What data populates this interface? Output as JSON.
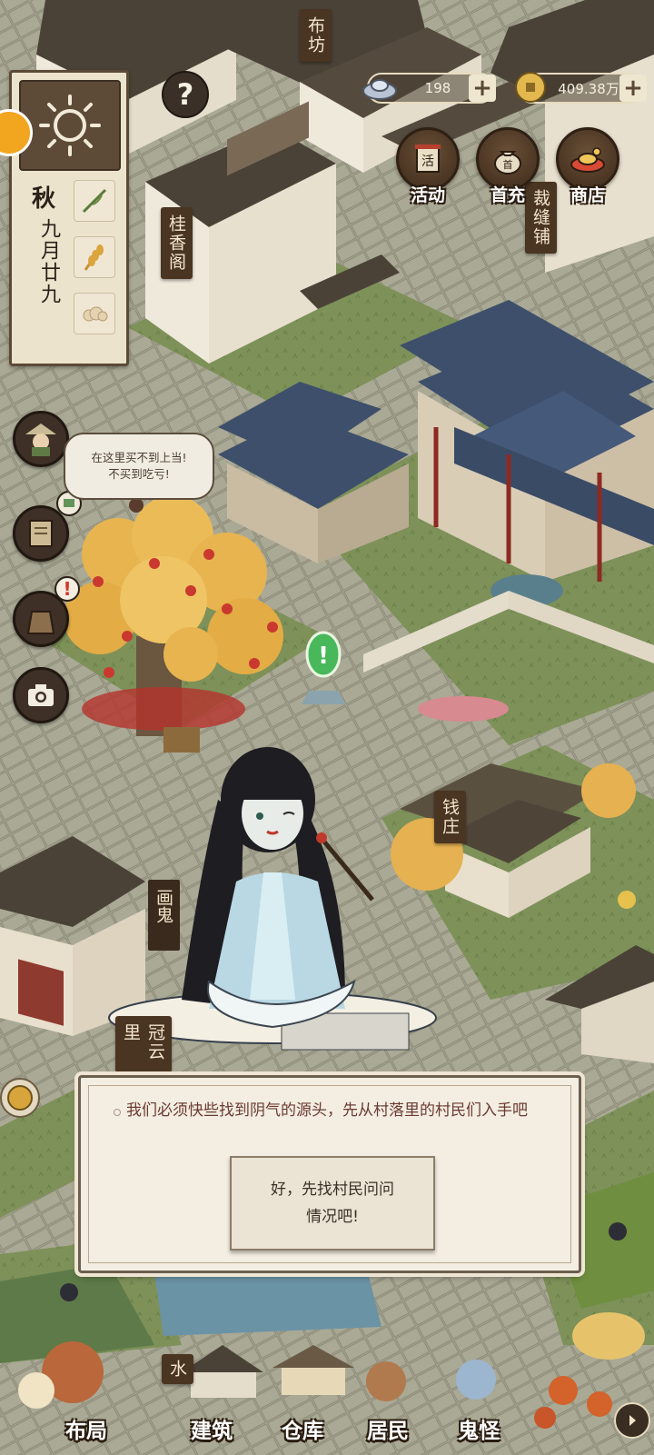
{
  "resources": [
    {
      "name": "ingot",
      "value": "198"
    },
    {
      "name": "coins",
      "value": "409.38万"
    }
  ],
  "top_buttons": [
    {
      "label": "活动",
      "icon": "scroll-icon"
    },
    {
      "label": "首充",
      "icon": "money-bag-icon"
    },
    {
      "label": "商店",
      "icon": "treasure-icon"
    }
  ],
  "calendar": {
    "season": "秋",
    "date": "九月廿九",
    "weather_icon": "sun-icon"
  },
  "buildings": {
    "bufang": "布坊",
    "guixiangge": "桂香阁",
    "caifengpu": "裁缝铺",
    "qianzhuang": "钱庄",
    "guanyunlou": "冠云里",
    "water": "水"
  },
  "speech_bubble": {
    "line1": "在这里买不到上当!",
    "line2": "不买到吃亏!"
  },
  "npc": {
    "name": "画鬼"
  },
  "dialog": {
    "text": "我们必须快些找到阴气的源头，先从村落里的村民们入手吧",
    "choice_line1": "好，先找村民问问",
    "choice_line2": "情况吧!"
  },
  "bottom_nav": [
    {
      "label": "布局"
    },
    {
      "label": "建筑"
    },
    {
      "label": "仓库"
    },
    {
      "label": "居民"
    },
    {
      "label": "鬼怪"
    }
  ],
  "colors": {
    "ground": "#7f8a62",
    "paving": "#9a9a86",
    "roof_blue": "#3d4f6b",
    "roof_dark": "#4a4237",
    "tree_gold": "#e8b450",
    "dialog_text": "#6b3b32"
  }
}
